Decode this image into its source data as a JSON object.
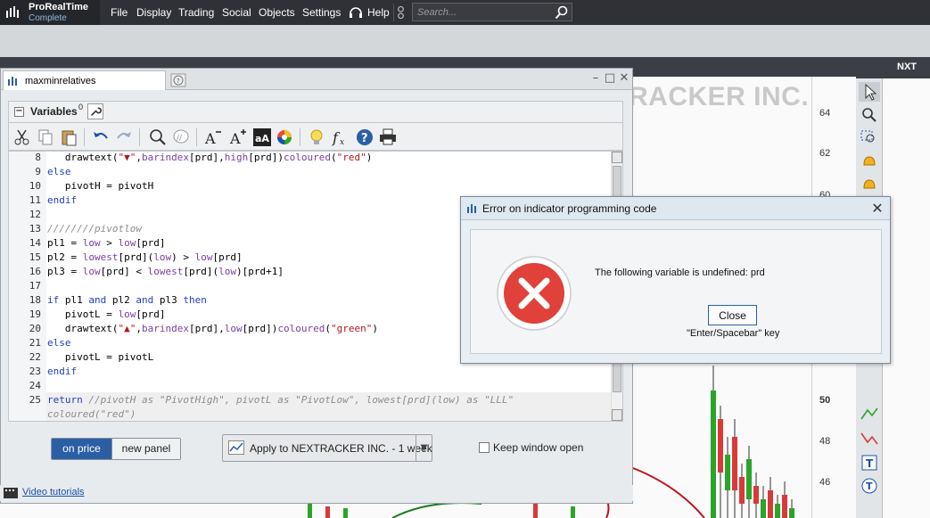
{
  "app": {
    "brand": "ProRealTime",
    "edition": "Complete"
  },
  "menu": {
    "items": [
      "File",
      "Display",
      "Trading",
      "Social",
      "Objects",
      "Settings"
    ],
    "help": "Help"
  },
  "search": {
    "placeholder": "Search..."
  },
  "background": {
    "chart_title_partial": "RACKER INC.",
    "price_labels": [
      "64",
      "62",
      "60",
      "50",
      "48",
      "46"
    ],
    "right_ticker": "NXT"
  },
  "editor": {
    "name": "maxminrelatives",
    "variables_label": "Variables",
    "variables_count": "0",
    "code_lines": [
      {
        "n": "8",
        "html": "   drawtext(<span class=\"st\">\"▼\"</span>,<span class=\"fn\">barindex</span>[prd],<span class=\"fn\">high</span>[prd])<span class=\"fn\">coloured</span>(<span class=\"st\">\"red\"</span>)"
      },
      {
        "n": "9",
        "html": "<span class=\"kw\">else</span>"
      },
      {
        "n": "10",
        "html": "   pivotH = pivotH"
      },
      {
        "n": "11",
        "html": "<span class=\"kw\">endif</span>"
      },
      {
        "n": "12",
        "html": ""
      },
      {
        "n": "13",
        "html": "<span class=\"cm\">////////pivotlow</span>"
      },
      {
        "n": "14",
        "html": "pl1 = <span class=\"fn\">low</span> &gt; <span class=\"fn\">low</span>[prd]"
      },
      {
        "n": "15",
        "html": "pl2 = <span class=\"fn\">lowest</span>[prd](<span class=\"fn\">low</span>) &gt; <span class=\"fn\">low</span>[prd]"
      },
      {
        "n": "16",
        "html": "pl3 = <span class=\"fn\">low</span>[prd] &lt; <span class=\"fn\">lowest</span>[prd](<span class=\"fn\">low</span>)[prd+1]"
      },
      {
        "n": "17",
        "html": ""
      },
      {
        "n": "18",
        "html": "<span class=\"kw\">if</span> pl1 <span class=\"kw\">and</span> pl2 <span class=\"kw\">and</span> pl3 <span class=\"kw\">then</span>"
      },
      {
        "n": "19",
        "html": "   pivotL = <span class=\"fn\">low</span>[prd]"
      },
      {
        "n": "20",
        "html": "   drawtext(<span class=\"st\">\"▲\"</span>,<span class=\"fn\">barindex</span>[prd],<span class=\"fn\">low</span>[prd])<span class=\"fn\">coloured</span>(<span class=\"st\">\"green\"</span>)"
      },
      {
        "n": "21",
        "html": "<span class=\"kw\">else</span>"
      },
      {
        "n": "22",
        "html": "   pivotL = pivotL"
      },
      {
        "n": "23",
        "html": "<span class=\"kw\">endif</span>"
      },
      {
        "n": "24",
        "html": ""
      },
      {
        "n": "25",
        "html": "<span class=\"kw\">return</span> <span class=\"cm\">//pivotH as \"PivotHigh\", pivotL as \"PivotLow\", lowest[prd](low) as \"LLL\"</span>"
      },
      {
        "n": "",
        "html": "<span class=\"cm\">coloured(\"red\")</span>"
      }
    ],
    "on_price": "on price",
    "new_panel": "new panel",
    "apply_label": "Apply to NEXTRACKER INC. - 1 week",
    "keep_open": "Keep window open",
    "video_tutorials": "Video tutorials"
  },
  "dialog": {
    "title": "Error on indicator programming code",
    "message": "The following variable is undefined: prd",
    "button": "Close",
    "hint": "\"Enter/Spacebar\" key"
  },
  "colors": {
    "accent": "#2b5fa5",
    "error_red": "#e0413a",
    "menubar": "#2f3136"
  }
}
